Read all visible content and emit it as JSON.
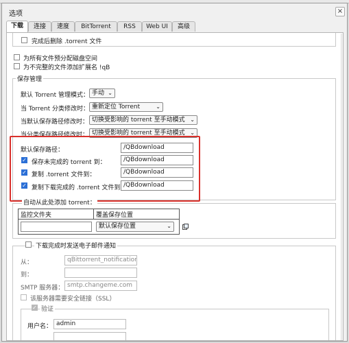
{
  "window": {
    "title": "选项",
    "close_glyph": "×"
  },
  "tabs": [
    "下载",
    "连接",
    "速度",
    "BitTorrent",
    "RSS",
    "Web UI",
    "高级"
  ],
  "top_options": {
    "delete_torrent": "完成后删除 .torrent 文件",
    "preallocate": "为所有文件预分配磁盘空间",
    "append_qb": "为不完整的文件添加扩展名 !qB"
  },
  "save_management": {
    "legend": "保存管理",
    "rows": [
      {
        "label": "默认 Torrent 管理模式：",
        "value": "手动"
      },
      {
        "label": "当 Torrent 分类修改时：",
        "value": "重新定位 Torrent"
      },
      {
        "label": "当默认保存路径修改时：",
        "value": "切换受影响的 torrent 至手动模式"
      },
      {
        "label": "当分类保存路径修改时：",
        "value": "切换受影响的 torrent 至手动模式"
      }
    ]
  },
  "paths": {
    "default_label": "默认保存路径：",
    "default_value": "/QBdownload",
    "incomplete_label": "保存未完成的 torrent 到：",
    "incomplete_value": "/QBdownload",
    "copy_torrent_label": "复制 .torrent 文件到：",
    "copy_torrent_value": "/QBdownload",
    "copy_finished_label": "复制下载完成的 .torrent 文件到：",
    "copy_finished_value": "/QBdownload"
  },
  "autoadd": {
    "legend": "自动从此处添加 torrent：",
    "col_folder": "监控文件夹",
    "col_override": "覆盖保存位置",
    "override_value": "默认保存位置"
  },
  "email": {
    "legend": "下载完成时发送电子邮件通知",
    "from_label": "从：",
    "from_placeholder": "qBittorrent_notification@",
    "to_label": "到：",
    "smtp_label": "SMTP 服务器：",
    "smtp_placeholder": "smtp.changeme.com",
    "ssl_label": "该服务器需要安全链接（SSL）",
    "auth_legend": "验证",
    "user_label": "用户名：",
    "user_value": "admin"
  },
  "colors": {
    "accent": "#2b6fd6",
    "highlight": "#d9302b"
  }
}
